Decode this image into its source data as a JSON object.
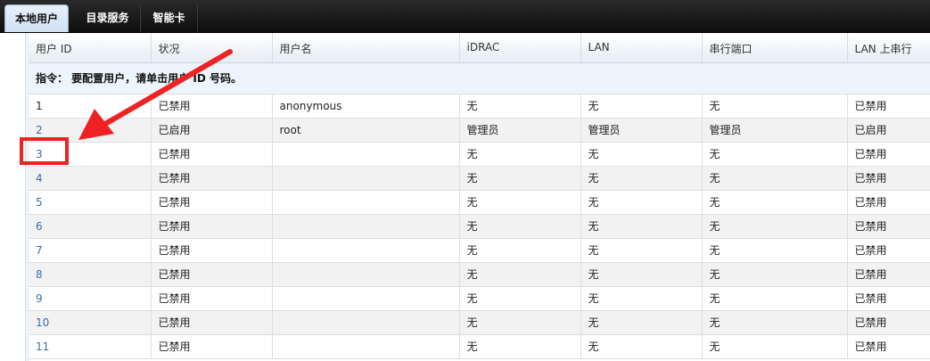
{
  "tabs": [
    {
      "label": "本地用户",
      "active": true
    },
    {
      "label": "目录服务",
      "active": false
    },
    {
      "label": "智能卡",
      "active": false
    }
  ],
  "table": {
    "columns": [
      "用户 ID",
      "状况",
      "用户名",
      "iDRAC",
      "LAN",
      "串行端口",
      "LAN 上串行"
    ],
    "instruction": "指令： 要配置用户，请单击用户 ID 号码。",
    "rows": [
      {
        "id": "1",
        "status": "已禁用",
        "username": "anonymous",
        "idrac": "无",
        "lan": "无",
        "serial": "无",
        "sol": "已禁用"
      },
      {
        "id": "2",
        "status": "已启用",
        "username": "root",
        "idrac": "管理员",
        "lan": "管理员",
        "serial": "管理员",
        "sol": "已启用"
      },
      {
        "id": "3",
        "status": "已禁用",
        "username": "",
        "idrac": "无",
        "lan": "无",
        "serial": "无",
        "sol": "已禁用"
      },
      {
        "id": "4",
        "status": "已禁用",
        "username": "",
        "idrac": "无",
        "lan": "无",
        "serial": "无",
        "sol": "已禁用"
      },
      {
        "id": "5",
        "status": "已禁用",
        "username": "",
        "idrac": "无",
        "lan": "无",
        "serial": "无",
        "sol": "已禁用"
      },
      {
        "id": "6",
        "status": "已禁用",
        "username": "",
        "idrac": "无",
        "lan": "无",
        "serial": "无",
        "sol": "已禁用"
      },
      {
        "id": "7",
        "status": "已禁用",
        "username": "",
        "idrac": "无",
        "lan": "无",
        "serial": "无",
        "sol": "已禁用"
      },
      {
        "id": "8",
        "status": "已禁用",
        "username": "",
        "idrac": "无",
        "lan": "无",
        "serial": "无",
        "sol": "已禁用"
      },
      {
        "id": "9",
        "status": "已禁用",
        "username": "",
        "idrac": "无",
        "lan": "无",
        "serial": "无",
        "sol": "已禁用"
      },
      {
        "id": "10",
        "status": "已禁用",
        "username": "",
        "idrac": "无",
        "lan": "无",
        "serial": "无",
        "sol": "已禁用"
      },
      {
        "id": "11",
        "status": "已禁用",
        "username": "",
        "idrac": "无",
        "lan": "无",
        "serial": "无",
        "sol": "已禁用"
      }
    ]
  },
  "colors": {
    "accent": "#3a6ea5",
    "annotation": "#ee2222"
  }
}
